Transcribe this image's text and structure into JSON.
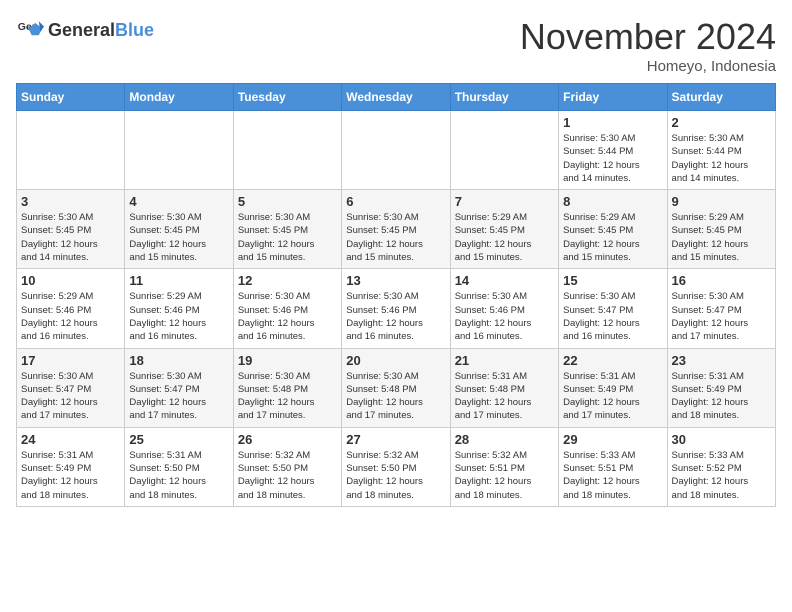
{
  "header": {
    "logo_general": "General",
    "logo_blue": "Blue",
    "month_title": "November 2024",
    "location": "Homeyo, Indonesia"
  },
  "columns": [
    "Sunday",
    "Monday",
    "Tuesday",
    "Wednesday",
    "Thursday",
    "Friday",
    "Saturday"
  ],
  "weeks": [
    [
      {
        "day": "",
        "info": ""
      },
      {
        "day": "",
        "info": ""
      },
      {
        "day": "",
        "info": ""
      },
      {
        "day": "",
        "info": ""
      },
      {
        "day": "",
        "info": ""
      },
      {
        "day": "1",
        "info": "Sunrise: 5:30 AM\nSunset: 5:44 PM\nDaylight: 12 hours\nand 14 minutes."
      },
      {
        "day": "2",
        "info": "Sunrise: 5:30 AM\nSunset: 5:44 PM\nDaylight: 12 hours\nand 14 minutes."
      }
    ],
    [
      {
        "day": "3",
        "info": "Sunrise: 5:30 AM\nSunset: 5:45 PM\nDaylight: 12 hours\nand 14 minutes."
      },
      {
        "day": "4",
        "info": "Sunrise: 5:30 AM\nSunset: 5:45 PM\nDaylight: 12 hours\nand 15 minutes."
      },
      {
        "day": "5",
        "info": "Sunrise: 5:30 AM\nSunset: 5:45 PM\nDaylight: 12 hours\nand 15 minutes."
      },
      {
        "day": "6",
        "info": "Sunrise: 5:30 AM\nSunset: 5:45 PM\nDaylight: 12 hours\nand 15 minutes."
      },
      {
        "day": "7",
        "info": "Sunrise: 5:29 AM\nSunset: 5:45 PM\nDaylight: 12 hours\nand 15 minutes."
      },
      {
        "day": "8",
        "info": "Sunrise: 5:29 AM\nSunset: 5:45 PM\nDaylight: 12 hours\nand 15 minutes."
      },
      {
        "day": "9",
        "info": "Sunrise: 5:29 AM\nSunset: 5:45 PM\nDaylight: 12 hours\nand 15 minutes."
      }
    ],
    [
      {
        "day": "10",
        "info": "Sunrise: 5:29 AM\nSunset: 5:46 PM\nDaylight: 12 hours\nand 16 minutes."
      },
      {
        "day": "11",
        "info": "Sunrise: 5:29 AM\nSunset: 5:46 PM\nDaylight: 12 hours\nand 16 minutes."
      },
      {
        "day": "12",
        "info": "Sunrise: 5:30 AM\nSunset: 5:46 PM\nDaylight: 12 hours\nand 16 minutes."
      },
      {
        "day": "13",
        "info": "Sunrise: 5:30 AM\nSunset: 5:46 PM\nDaylight: 12 hours\nand 16 minutes."
      },
      {
        "day": "14",
        "info": "Sunrise: 5:30 AM\nSunset: 5:46 PM\nDaylight: 12 hours\nand 16 minutes."
      },
      {
        "day": "15",
        "info": "Sunrise: 5:30 AM\nSunset: 5:47 PM\nDaylight: 12 hours\nand 16 minutes."
      },
      {
        "day": "16",
        "info": "Sunrise: 5:30 AM\nSunset: 5:47 PM\nDaylight: 12 hours\nand 17 minutes."
      }
    ],
    [
      {
        "day": "17",
        "info": "Sunrise: 5:30 AM\nSunset: 5:47 PM\nDaylight: 12 hours\nand 17 minutes."
      },
      {
        "day": "18",
        "info": "Sunrise: 5:30 AM\nSunset: 5:47 PM\nDaylight: 12 hours\nand 17 minutes."
      },
      {
        "day": "19",
        "info": "Sunrise: 5:30 AM\nSunset: 5:48 PM\nDaylight: 12 hours\nand 17 minutes."
      },
      {
        "day": "20",
        "info": "Sunrise: 5:30 AM\nSunset: 5:48 PM\nDaylight: 12 hours\nand 17 minutes."
      },
      {
        "day": "21",
        "info": "Sunrise: 5:31 AM\nSunset: 5:48 PM\nDaylight: 12 hours\nand 17 minutes."
      },
      {
        "day": "22",
        "info": "Sunrise: 5:31 AM\nSunset: 5:49 PM\nDaylight: 12 hours\nand 17 minutes."
      },
      {
        "day": "23",
        "info": "Sunrise: 5:31 AM\nSunset: 5:49 PM\nDaylight: 12 hours\nand 18 minutes."
      }
    ],
    [
      {
        "day": "24",
        "info": "Sunrise: 5:31 AM\nSunset: 5:49 PM\nDaylight: 12 hours\nand 18 minutes."
      },
      {
        "day": "25",
        "info": "Sunrise: 5:31 AM\nSunset: 5:50 PM\nDaylight: 12 hours\nand 18 minutes."
      },
      {
        "day": "26",
        "info": "Sunrise: 5:32 AM\nSunset: 5:50 PM\nDaylight: 12 hours\nand 18 minutes."
      },
      {
        "day": "27",
        "info": "Sunrise: 5:32 AM\nSunset: 5:50 PM\nDaylight: 12 hours\nand 18 minutes."
      },
      {
        "day": "28",
        "info": "Sunrise: 5:32 AM\nSunset: 5:51 PM\nDaylight: 12 hours\nand 18 minutes."
      },
      {
        "day": "29",
        "info": "Sunrise: 5:33 AM\nSunset: 5:51 PM\nDaylight: 12 hours\nand 18 minutes."
      },
      {
        "day": "30",
        "info": "Sunrise: 5:33 AM\nSunset: 5:52 PM\nDaylight: 12 hours\nand 18 minutes."
      }
    ]
  ]
}
